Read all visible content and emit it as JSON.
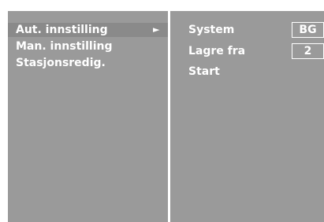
{
  "menu": {
    "items": [
      {
        "label": "Aut. innstilling",
        "arrow": "►"
      },
      {
        "label": "Man. innstilling"
      },
      {
        "label": "Stasjonsredig."
      }
    ]
  },
  "settings": {
    "system": {
      "label": "System",
      "value": "BG"
    },
    "store_from": {
      "label": "Lagre fra",
      "value": "2"
    },
    "start": {
      "label": "Start"
    }
  },
  "colors": {
    "panel_bg": "#9a9a9a",
    "highlight_bg": "#8a8a8a",
    "text": "#ffffff",
    "divider": "#ffffff"
  }
}
